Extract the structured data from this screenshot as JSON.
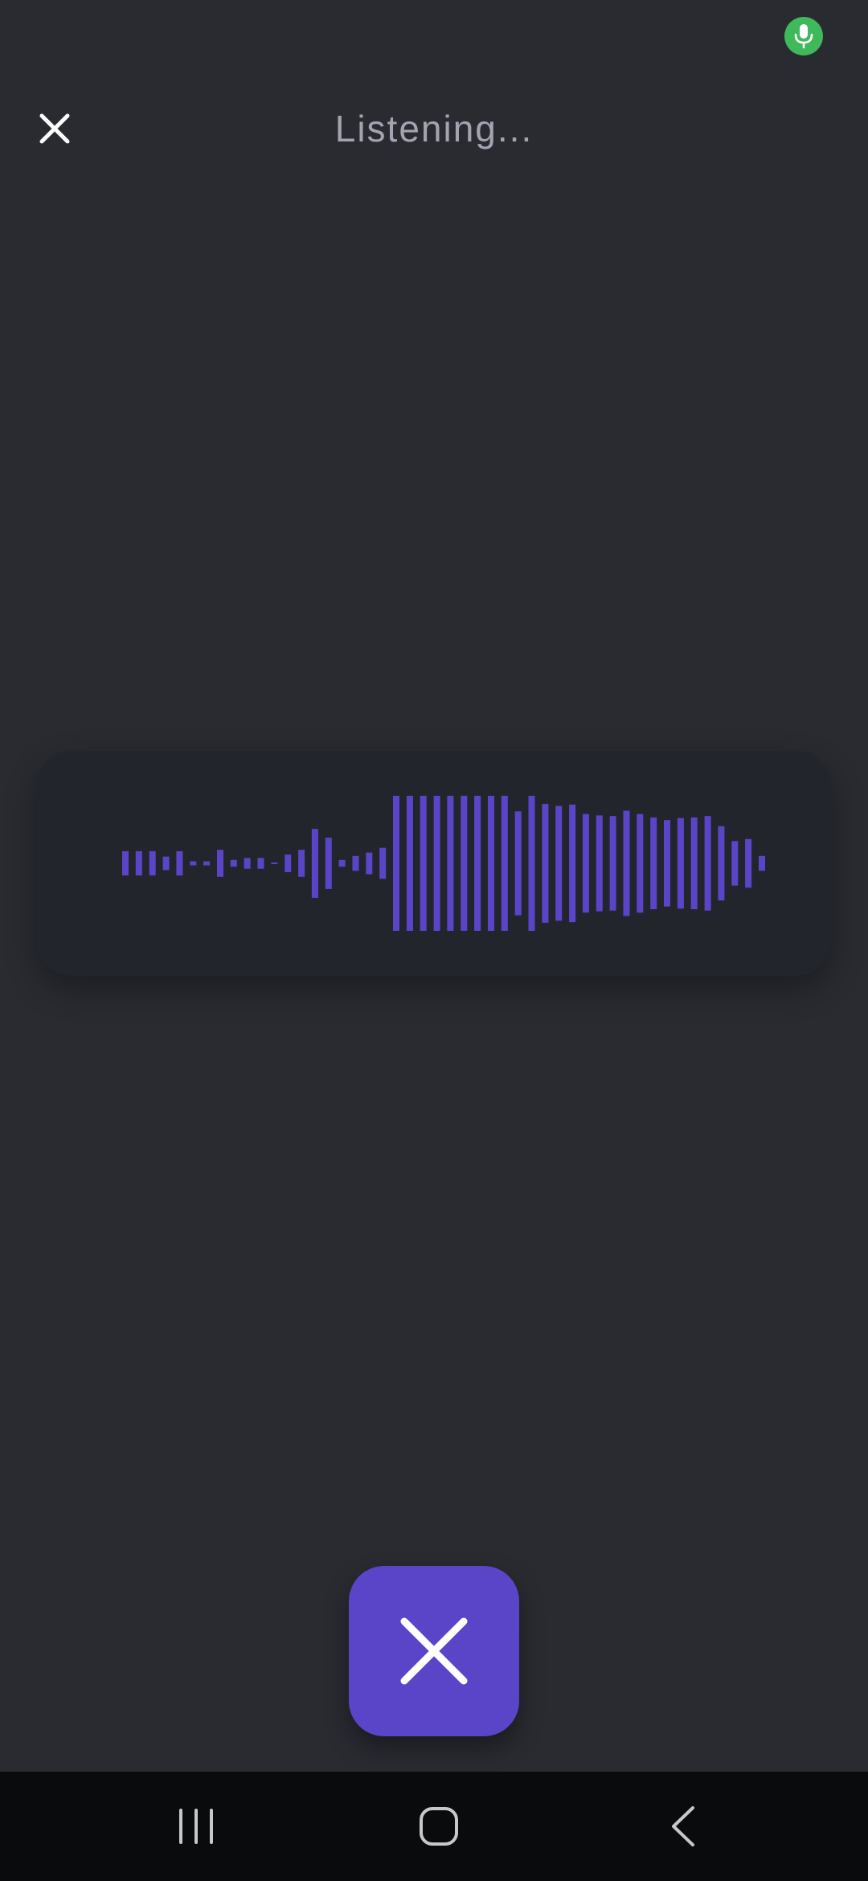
{
  "status_bar": {
    "mic_indicator_icon": "microphone-icon",
    "mic_indicator_color": "#3fb95a"
  },
  "header": {
    "close_icon": "close-icon",
    "title": "Listening..."
  },
  "waveform": {
    "icon": "audio-waveform",
    "bar_color": "#5a45c9",
    "levels": [
      0.18,
      0.18,
      0.18,
      0.1,
      0.18,
      0.03,
      0.03,
      0.2,
      0.05,
      0.08,
      0.08,
      0.01,
      0.13,
      0.2,
      0.51,
      0.38,
      0.05,
      0.11,
      0.16,
      0.23,
      1.0,
      1.0,
      1.0,
      1.0,
      1.0,
      1.0,
      1.0,
      1.0,
      1.0,
      0.77,
      1.0,
      0.88,
      0.85,
      0.87,
      0.73,
      0.71,
      0.7,
      0.78,
      0.73,
      0.68,
      0.64,
      0.67,
      0.68,
      0.7,
      0.55,
      0.33,
      0.36,
      0.11
    ]
  },
  "stop_button": {
    "icon": "close-icon",
    "color": "#5a45c9"
  },
  "nav_bar": {
    "recents_icon": "recents-icon",
    "home_icon": "home-icon",
    "back_icon": "back-icon"
  }
}
